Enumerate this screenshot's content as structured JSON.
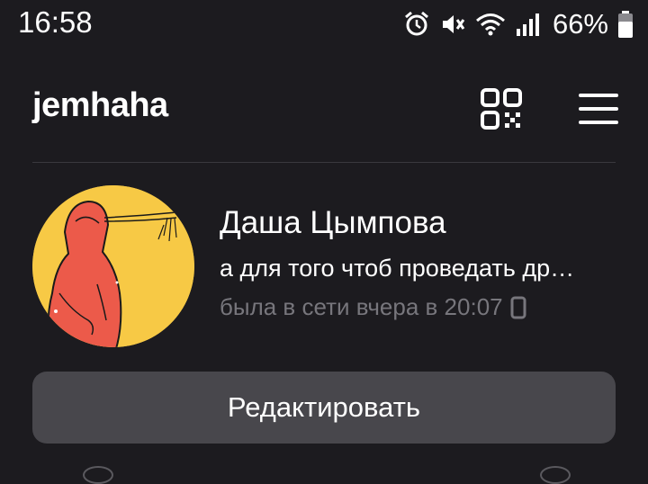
{
  "status_bar": {
    "time": "16:58",
    "battery": "66%",
    "icons": [
      "alarm-icon",
      "mute-icon",
      "wifi-icon",
      "signal-icon",
      "battery-icon"
    ]
  },
  "header": {
    "username": "jemhaha",
    "icons": [
      "qr-code-icon",
      "hamburger-menu-icon"
    ]
  },
  "profile": {
    "name": "Даша Цымпова",
    "status": "а для того чтоб проведать др…",
    "last_seen": "была в сети вчера в 20:07",
    "last_seen_icon": "phone-icon"
  },
  "actions": {
    "edit_label": "Редактировать"
  },
  "colors": {
    "background": "#1c1b1f",
    "button": "#48474c",
    "avatar_bg": "#f7c945",
    "avatar_figure": "#ec5a4a",
    "muted_text": "#77767c"
  }
}
